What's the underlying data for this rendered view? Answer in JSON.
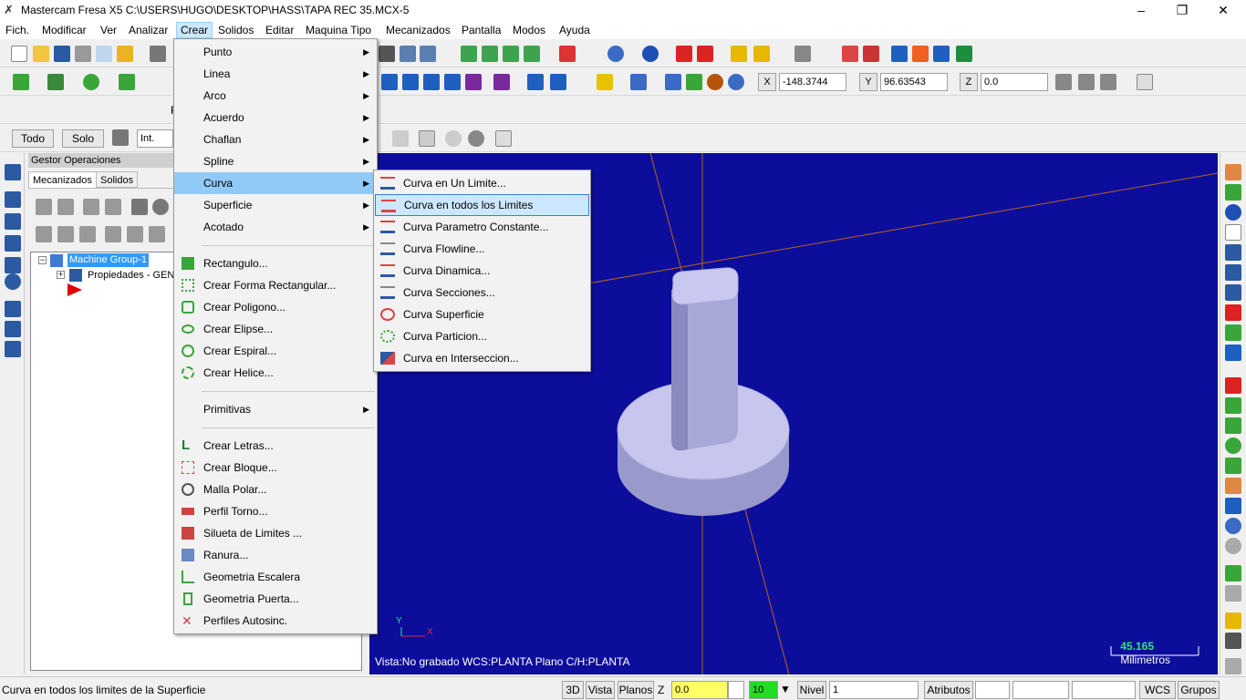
{
  "window": {
    "title": "Mastercam Fresa X5  C:\\USERS\\HUGO\\DESKTOP\\HASS\\TAPA REC 35.MCX-5",
    "minimize": "–",
    "maximize": "❐",
    "close": "✕"
  },
  "menubar": [
    "Fich.",
    "Modificar",
    "Ver",
    "Analizar",
    "Crear",
    "Solidos",
    "Editar",
    "Maquina Tipo",
    "Mecanizados",
    "Pantalla",
    "Modos",
    "Ayuda"
  ],
  "coords": {
    "x_label": "X",
    "x_value": "-148.3744",
    "y_label": "Y",
    "y_value": "96.63543",
    "z_label": "Z",
    "z_value": "0.0"
  },
  "selection_bar": {
    "todo": "Todo",
    "solo": "Solo",
    "int": "Int.",
    "ribbon_letter": "F"
  },
  "operations": {
    "header": "Gestor Operaciones",
    "tab_mecanizados": "Mecanizados",
    "tab_solidos": "Solidos",
    "tree_group": "Machine Group-1",
    "tree_props": "Propiedades - GENE"
  },
  "crear_menu": [
    {
      "label": "Punto",
      "submenu": true
    },
    {
      "label": "Linea",
      "submenu": true
    },
    {
      "label": "Arco",
      "submenu": true
    },
    {
      "label": "Acuerdo",
      "submenu": true
    },
    {
      "label": "Chaflan",
      "submenu": true
    },
    {
      "label": "Spline",
      "submenu": true
    },
    {
      "label": "Curva",
      "submenu": true
    },
    {
      "label": "Superficie",
      "submenu": true
    },
    {
      "label": "Acotado",
      "submenu": true
    },
    {
      "label": "Rectangulo..."
    },
    {
      "label": "Crear Forma Rectangular..."
    },
    {
      "label": "Crear Poligono..."
    },
    {
      "label": "Crear Elipse..."
    },
    {
      "label": "Crear Espiral..."
    },
    {
      "label": "Crear Helice..."
    },
    {
      "label": "Primitivas",
      "submenu": true
    },
    {
      "label": "Crear Letras..."
    },
    {
      "label": "Crear Bloque..."
    },
    {
      "label": "Malla Polar..."
    },
    {
      "label": "Perfil Torno..."
    },
    {
      "label": "Silueta de Limites ..."
    },
    {
      "label": "Ranura..."
    },
    {
      "label": "Geometria Escalera"
    },
    {
      "label": "Geometria Puerta..."
    },
    {
      "label": "Perfiles Autosinc."
    }
  ],
  "curva_menu": [
    "Curva en Un Limite...",
    "Curva en todos los Limites",
    "Curva Parametro Constante...",
    "Curva Flowline...",
    "Curva Dinamica...",
    "Curva Secciones...",
    "Curva Superficie",
    "Curva Particion...",
    "Curva en Interseccion..."
  ],
  "viewport": {
    "status": "Vista:No grabado   WCS:PLANTA   Plano C/H:PLANTA",
    "scale_value": "45.165",
    "scale_unit": "Milimetros",
    "axis_y": "Y",
    "axis_x": "X",
    "background": "#0d0d9c"
  },
  "statusbar": {
    "message": "Curva en todos los limites de la Superficie",
    "btn_3d": "3D",
    "btn_vista": "Vista",
    "btn_planos": "Planos",
    "z_label": "Z",
    "z_value": "0.0",
    "color_value": "10",
    "nivel_label": "Nivel",
    "nivel_value": "1",
    "atributos": "Atributos",
    "wcs": "WCS",
    "grupos": "Grupos"
  }
}
